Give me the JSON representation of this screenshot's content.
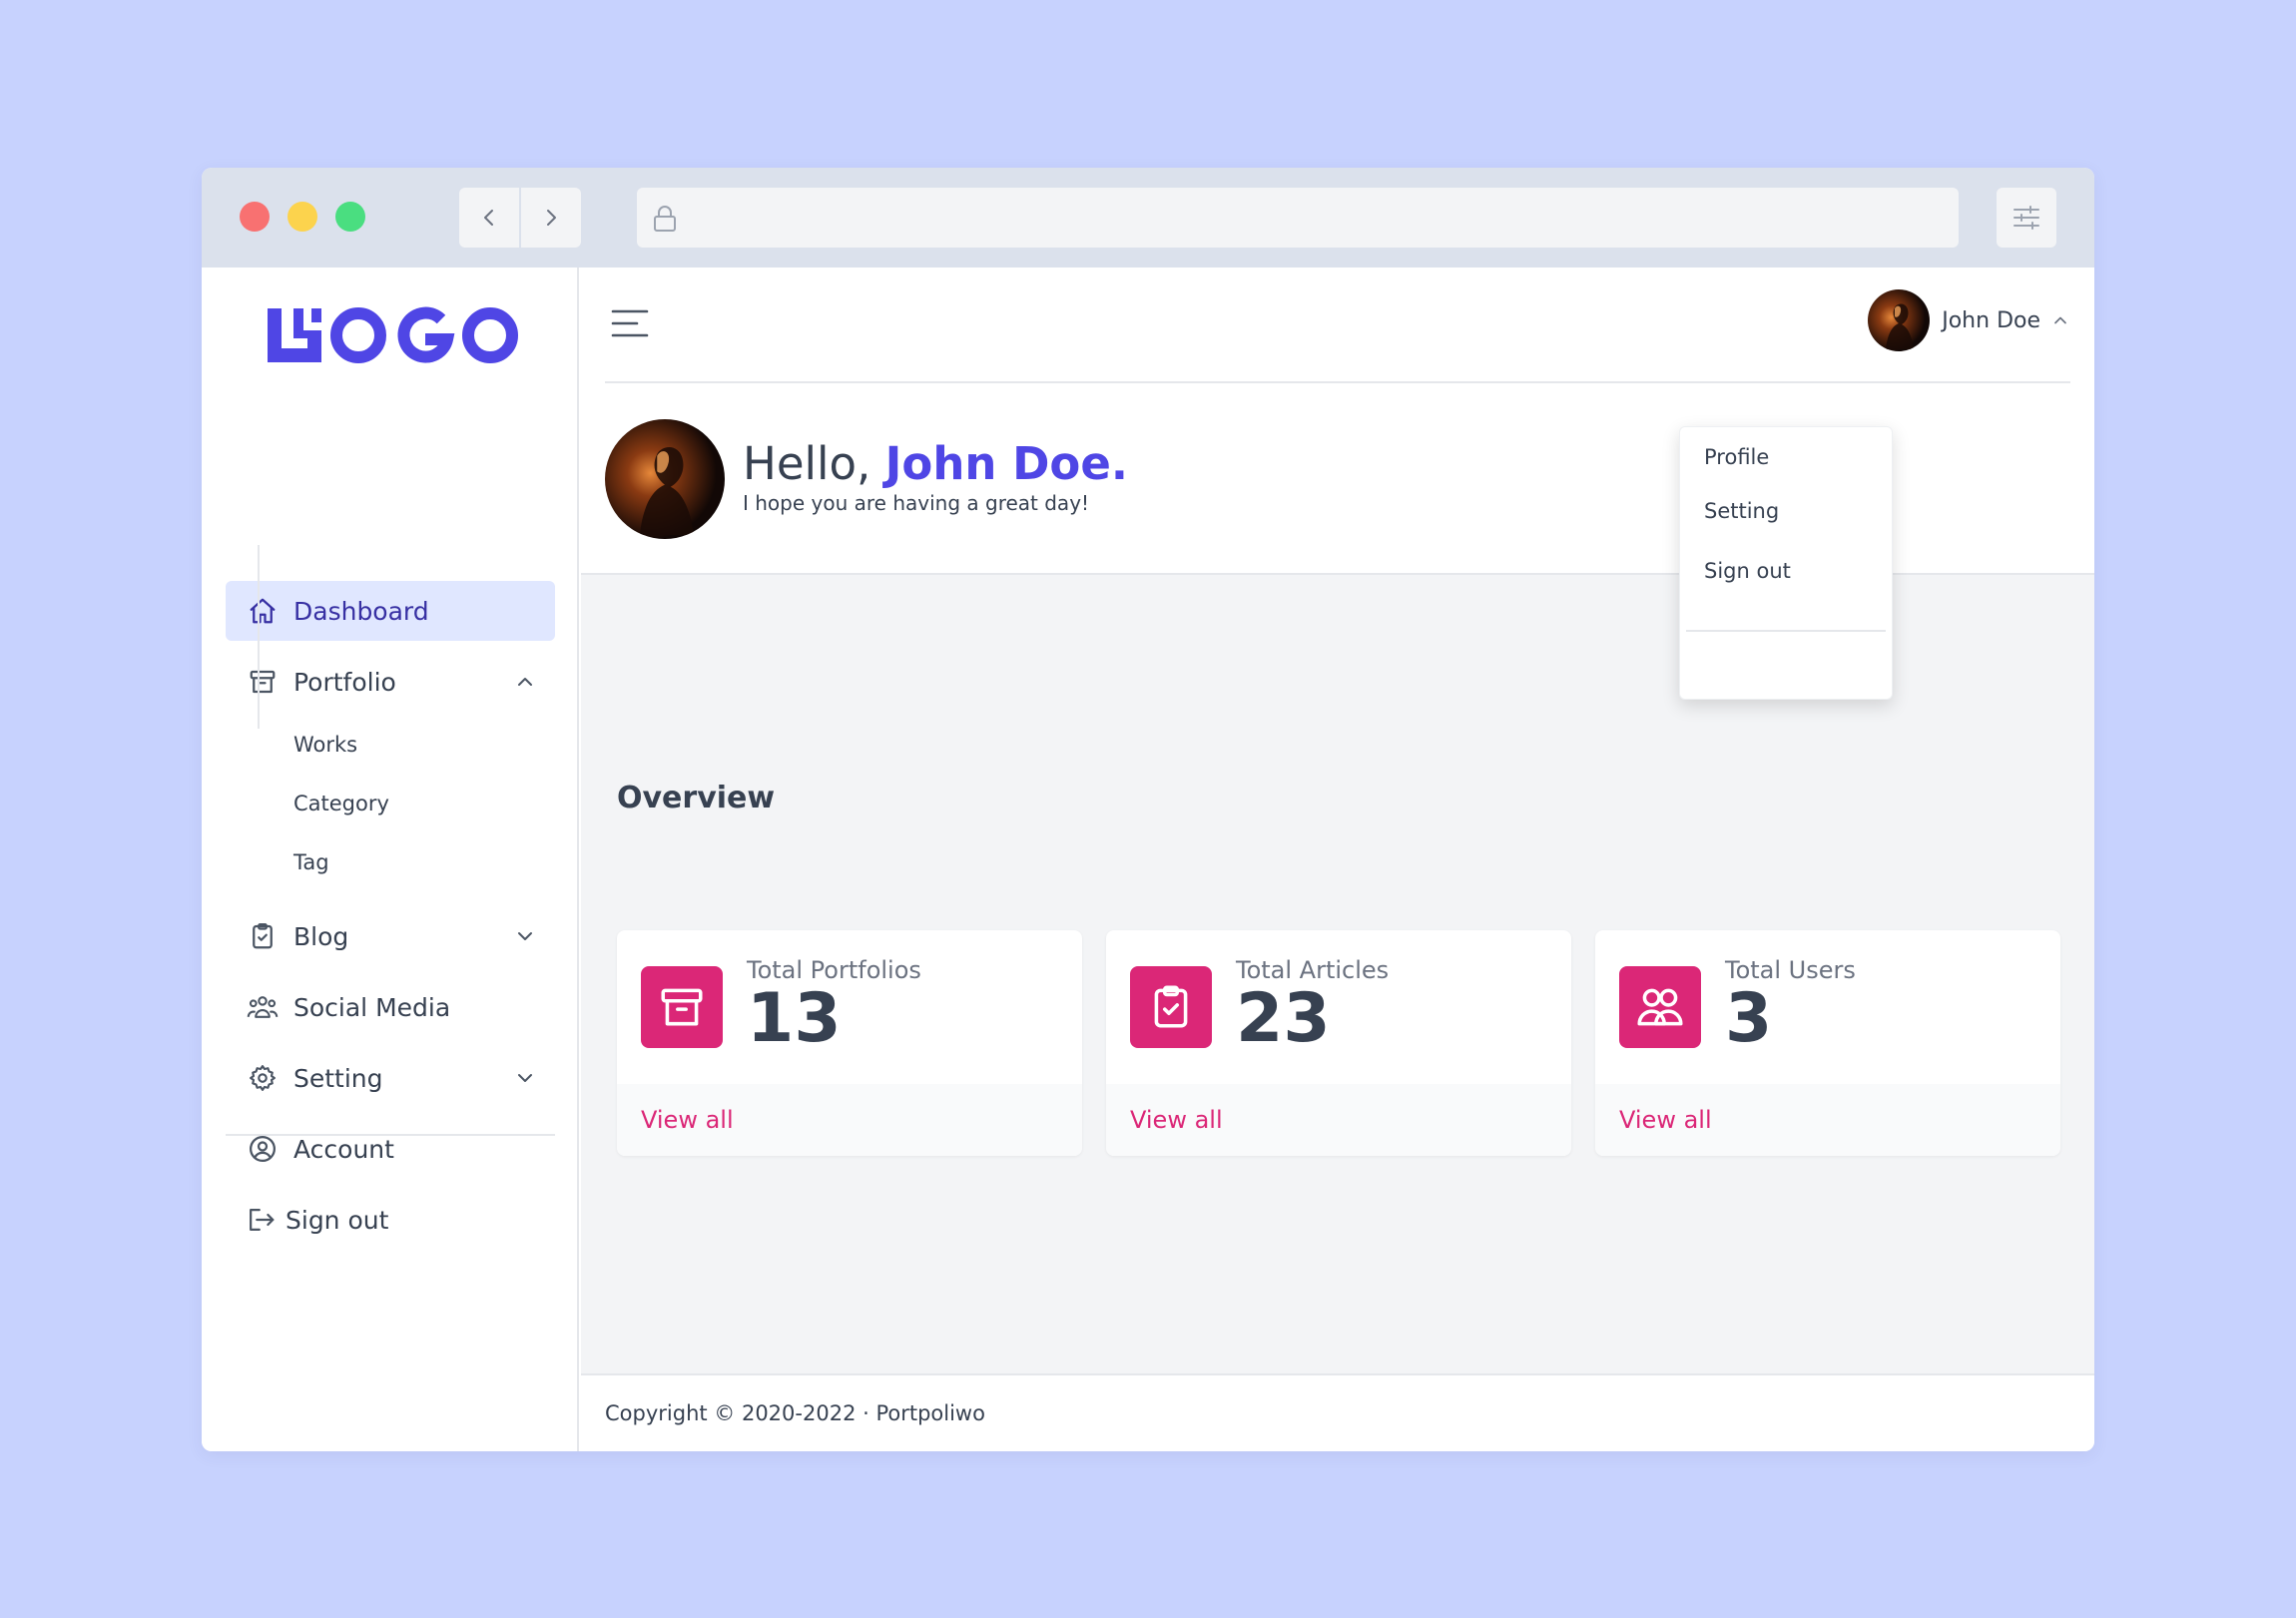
{
  "browser": {
    "icons": [
      "chevron-left-icon",
      "chevron-right-icon",
      "lock-icon",
      "adjustments-icon"
    ]
  },
  "logo": {
    "text": "LOGO"
  },
  "sidebar": {
    "items": [
      {
        "label": "Dashboard",
        "icon": "home-icon",
        "active": true
      },
      {
        "label": "Portfolio",
        "icon": "archive-icon",
        "expanded": true
      },
      {
        "label": "Blog",
        "icon": "clipboard-icon",
        "expanded": false
      },
      {
        "label": "Social Media",
        "icon": "users-group-icon"
      },
      {
        "label": "Setting",
        "icon": "gear-icon",
        "expanded": false
      },
      {
        "label": "Account",
        "icon": "user-circle-icon"
      }
    ],
    "portfolio_sub": [
      "Works",
      "Category",
      "Tag"
    ],
    "signout": "Sign out"
  },
  "header": {
    "user_name": "John Doe",
    "greeting": "Hello, ",
    "greeting_name": "John Doe.",
    "subtitle": "I hope you are having a great day!",
    "dropdown": [
      "Profile",
      "Setting",
      "Sign out"
    ]
  },
  "overview": {
    "title": "Overview",
    "cards": [
      {
        "label": "Total Portfolios",
        "value": "13",
        "link": "View all",
        "icon": "archive-icon"
      },
      {
        "label": "Total Articles",
        "value": "23",
        "link": "View all",
        "icon": "clipboard-check-icon"
      },
      {
        "label": "Total Users",
        "value": "3",
        "link": "View all",
        "icon": "users-icon"
      }
    ]
  },
  "footer": {
    "text": "Copyright © 2020-2022 · Portpoliwo"
  },
  "colors": {
    "accent": "#4f46e5",
    "pink": "#db2777",
    "page_bg": "#c7d2fe",
    "active_bg": "#e0e7ff"
  }
}
